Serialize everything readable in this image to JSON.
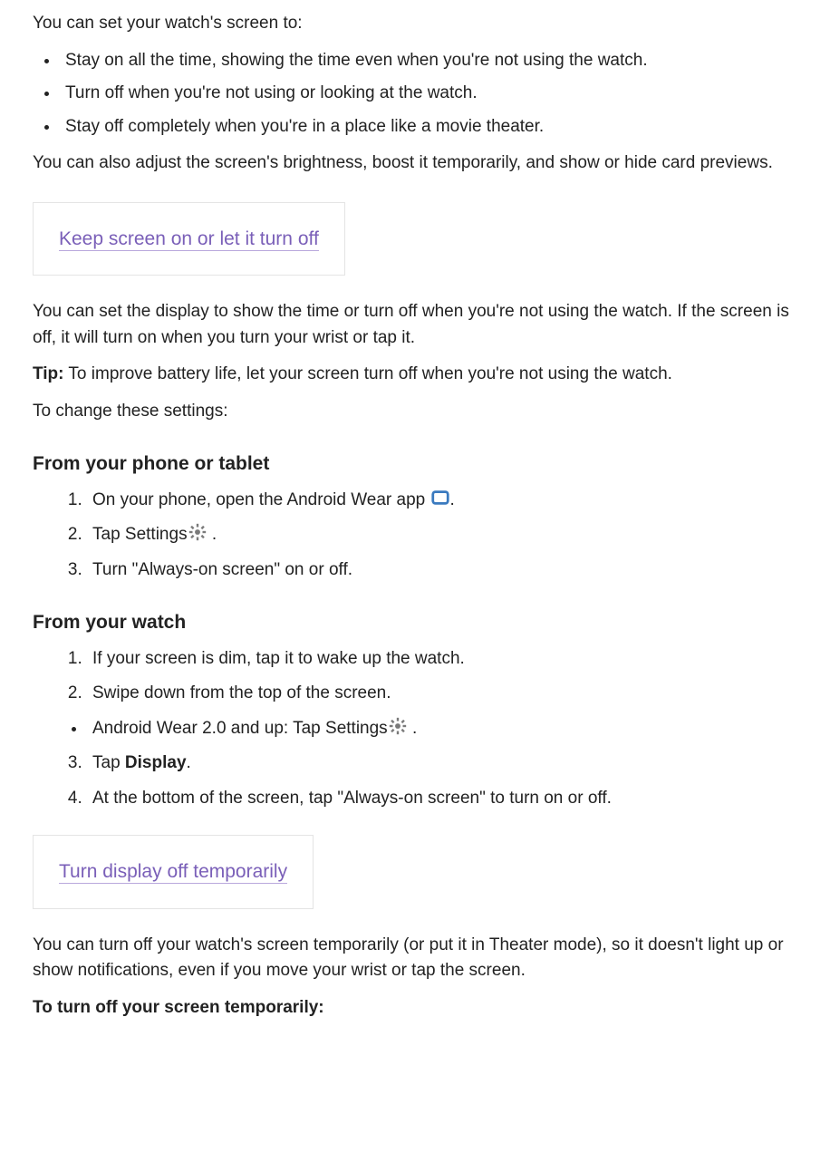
{
  "intro": "You can set your watch's screen to:",
  "options": [
    "Stay on all the time, showing the time even when you're not using the watch.",
    "Turn off when you're not using or looking at the watch.",
    "Stay off completely when you're in a place like a movie theater."
  ],
  "intro_after": "You can also adjust the screen's brightness, boost it temporarily, and show or hide card previews.",
  "card1": "Keep screen on or let it turn off",
  "section1": {
    "p1": "You can set the display to show the time or turn off when you're not using the watch. If the screen is off, it will turn on when you turn your wrist or tap it.",
    "tip_label": "Tip:",
    "tip_text": " To improve battery life, let your screen turn off when you're not using the watch.",
    "p2": "To change these settings:"
  },
  "phone": {
    "heading": "From your phone or tablet",
    "step1_pre": "On your phone, open the Android Wear app ",
    "step1_post": ".",
    "step2_pre": "Tap Settings",
    "step2_post": " .",
    "step3": "Turn \"Always-on screen\" on or off."
  },
  "watch": {
    "heading": "From your watch",
    "step1": "If your screen is dim, tap it to wake up the watch.",
    "step2": "Swipe down from the top of the screen.",
    "bullet_pre": "Android Wear 2.0 and up: Tap Settings",
    "bullet_post": " .",
    "step3_pre": "Tap ",
    "step3_bold": "Display",
    "step3_post": ".",
    "step4": "At the bottom of the screen, tap \"Always-on screen\" to turn on or off."
  },
  "card2": "Turn display off temporarily",
  "section2": {
    "p1": "You can turn off your watch's screen temporarily (or put it in Theater mode), so it doesn't light up or show notifications, even if you move your wrist or tap the screen.",
    "p2": "To turn off your screen temporarily:"
  },
  "icons": {
    "android_wear": "android-wear-icon",
    "gear": "gear-icon"
  }
}
